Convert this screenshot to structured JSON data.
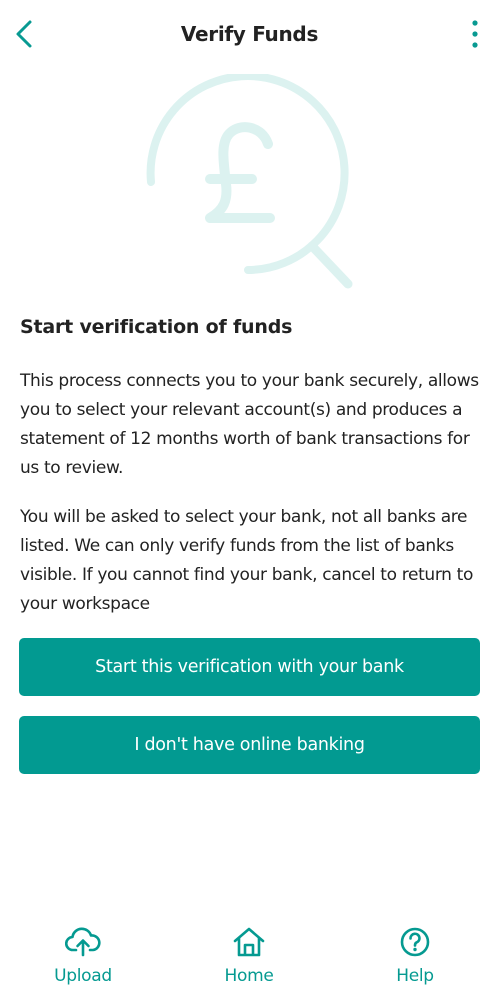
{
  "header": {
    "title": "Verify Funds",
    "back_icon": "chevron-left-icon",
    "menu_icon": "more-vertical-icon"
  },
  "hero": {
    "icon": "pound-search-icon",
    "color": "#dcf2f0"
  },
  "content": {
    "heading": "Start verification of funds",
    "paragraph1": "This process connects you to your bank securely, allows you to select your relevant account(s) and produces a statement of 12 months worth of bank transactions for us to review.",
    "paragraph2": "You will be asked to select your bank, not all banks are listed. We can only verify funds from the list of banks visible. If you cannot find your bank, cancel to return to your workspace"
  },
  "buttons": {
    "start_label": "Start this verification with your bank",
    "no_online_label": "I don't have online banking"
  },
  "nav": {
    "items": [
      {
        "label": "Upload",
        "icon": "cloud-upload-icon"
      },
      {
        "label": "Home",
        "icon": "home-icon"
      },
      {
        "label": "Help",
        "icon": "help-circle-icon"
      }
    ]
  },
  "colors": {
    "accent": "#029a91",
    "nav_text": "#059a91"
  }
}
